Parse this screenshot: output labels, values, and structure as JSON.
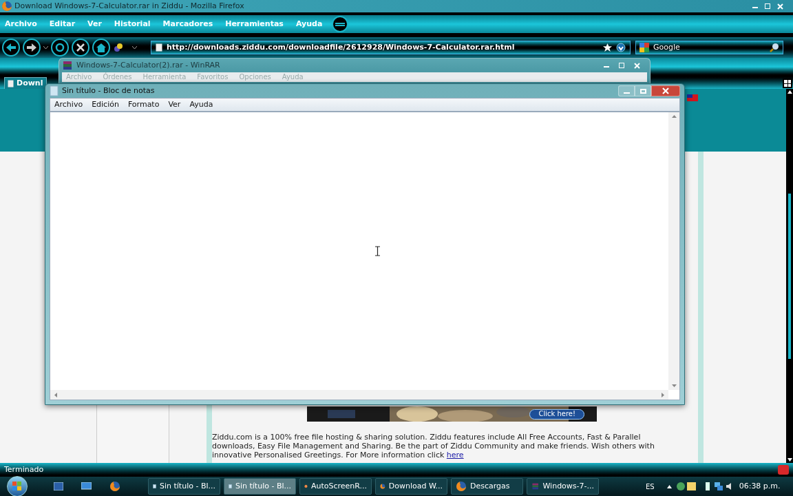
{
  "firefox": {
    "title": "Download Windows-7-Calculator.rar in Ziddu - Mozilla Firefox",
    "menu": [
      "Archivo",
      "Editar",
      "Ver",
      "Historial",
      "Marcadores",
      "Herramientas",
      "Ayuda"
    ],
    "url": "http://downloads.ziddu.com/downloadfile/2612928/Windows-7-Calculator.rar.html",
    "search": {
      "placeholder": "Google"
    },
    "tab": "Downl",
    "status": "Terminado"
  },
  "page": {
    "ad_button": "Click here!",
    "paragraph": "Ziddu.com is a 100% free file hosting & sharing solution. Ziddu features include All Free Accounts, Fast & Parallel downloads, Easy File Management and Sharing. Be the part of Ziddu Community and make friends. Wish others with innovative Personalised Greetings. For More information click",
    "link": "here"
  },
  "winrar": {
    "title": "Windows-7-Calculator(2).rar - WinRAR",
    "menu": [
      "Archivo",
      "Órdenes",
      "Herramienta",
      "Favoritos",
      "Opciones",
      "Ayuda"
    ]
  },
  "notepad": {
    "title": "Sin título - Bloc de notas",
    "menu": [
      "Archivo",
      "Edición",
      "Formato",
      "Ver",
      "Ayuda"
    ]
  },
  "taskbar": {
    "tasks": [
      {
        "label": "Sin título - Bl...",
        "kind": "notepad",
        "selected": false
      },
      {
        "label": "Sin título - Bl...",
        "kind": "notepad",
        "selected": true
      },
      {
        "label": "AutoScreenR...",
        "kind": "reel",
        "selected": false
      },
      {
        "label": "Download W...",
        "kind": "firefox",
        "selected": false
      },
      {
        "label": "Descargas",
        "kind": "firefox",
        "selected": false
      },
      {
        "label": "Windows-7-...",
        "kind": "winrar",
        "selected": false
      }
    ],
    "language": "ES",
    "clock": "06:38 p.m."
  }
}
